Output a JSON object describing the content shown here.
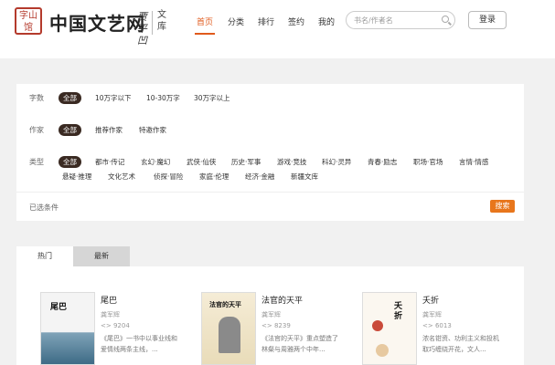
{
  "header": {
    "logo_seal": "字山馆",
    "logo_title": "中国文艺网",
    "logo_signature": "贾平凹",
    "logo_section": "文库",
    "nav": [
      {
        "label": "首页",
        "active": true
      },
      {
        "label": "分类",
        "active": false
      },
      {
        "label": "排行",
        "active": false
      },
      {
        "label": "签约",
        "active": false
      },
      {
        "label": "我的",
        "active": false
      }
    ],
    "search_placeholder": "书名/作者名",
    "login_label": "登录"
  },
  "filters": {
    "word_count": {
      "label": "字数",
      "options": [
        "全部",
        "10万字以下",
        "10-30万字",
        "30万字以上"
      ],
      "selected": "全部"
    },
    "author": {
      "label": "作家",
      "options": [
        "全部",
        "推荐作家",
        "特邀作家"
      ],
      "selected": "全部"
    },
    "genre": {
      "label": "类型",
      "options_row1": [
        "全部",
        "都市·传记",
        "玄幻·魔幻",
        "武侠·仙侠",
        "历史·军事",
        "游戏·竞技",
        "科幻·灵异",
        "青春·励志",
        "职场·官场",
        "言情·情感"
      ],
      "options_row2": [
        "悬疑·推理",
        "文化艺术",
        "侦探·冒险",
        "家庭·伦理",
        "经济·金融",
        "新疆文库"
      ],
      "selected": "全部"
    },
    "chosen_label": "已选条件",
    "search_button": "搜索"
  },
  "tabs": [
    "热门",
    "最新"
  ],
  "books": [
    {
      "title": "尾巴",
      "author": "龚军辉",
      "count": "9204",
      "desc": "《尾巴》一书中以事业线和爱情线两条主线，...",
      "cover_text": "尾巴"
    },
    {
      "title": "法官的天平",
      "author": "龚军辉",
      "count": "8239",
      "desc": "《法官的天平》重点塑造了林粲与周雅两个中年...",
      "cover_text": "法官的天平"
    },
    {
      "title": "夭折",
      "author": "龚军辉",
      "count": "6013",
      "desc": "浓名钳资、功利主义和投机取巧缠绕开花，文人...",
      "cover_text": "夭折"
    }
  ]
}
